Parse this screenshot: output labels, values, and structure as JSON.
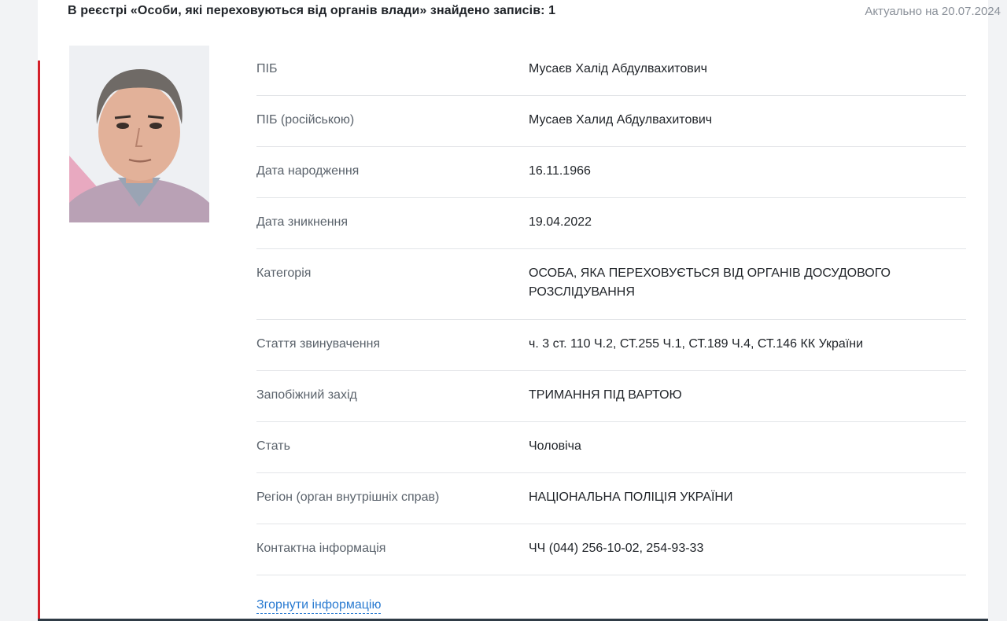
{
  "header": {
    "title": "В реєстрі «Особи, які переховуються від органів влади» знайдено записів: 1",
    "date": "Актуально на 20.07.2024"
  },
  "record": {
    "photo_icon": "person-photo",
    "fields": [
      {
        "label": "ПІБ",
        "value": "Мусаєв Халід Абдулвахитович"
      },
      {
        "label": "ПІБ (російською)",
        "value": "Мусаев Халид Абдулвахитович"
      },
      {
        "label": "Дата народження",
        "value": "16.11.1966"
      },
      {
        "label": "Дата зникнення",
        "value": "19.04.2022"
      },
      {
        "label": "Категорія",
        "value": "ОСОБА, ЯКА ПЕРЕХОВУЄТЬСЯ ВІД ОРГАНІВ ДОСУДОВОГО РОЗСЛІДУВАННЯ"
      },
      {
        "label": "Стаття звинувачення",
        "value": "ч. 3 ст. 110 Ч.2, СТ.255 Ч.1, СТ.189 Ч.4, СТ.146 КК України"
      },
      {
        "label": "Запобіжний захід",
        "value": "ТРИМАННЯ ПІД ВАРТОЮ"
      },
      {
        "label": "Стать",
        "value": "Чоловіча"
      },
      {
        "label": "Регіон (орган внутрішніх справ)",
        "value": "НАЦІОНАЛЬНА ПОЛІЦІЯ УКРАЇНИ"
      },
      {
        "label": "Контактна інформація",
        "value": "ЧЧ (044) 256-10-02, 254-93-33"
      }
    ],
    "collapse_label": "Згорнути інформацію"
  },
  "colors": {
    "accent": "#d4202a",
    "link": "#2a7bd1",
    "label": "#5a626b",
    "text": "#1f2328"
  }
}
